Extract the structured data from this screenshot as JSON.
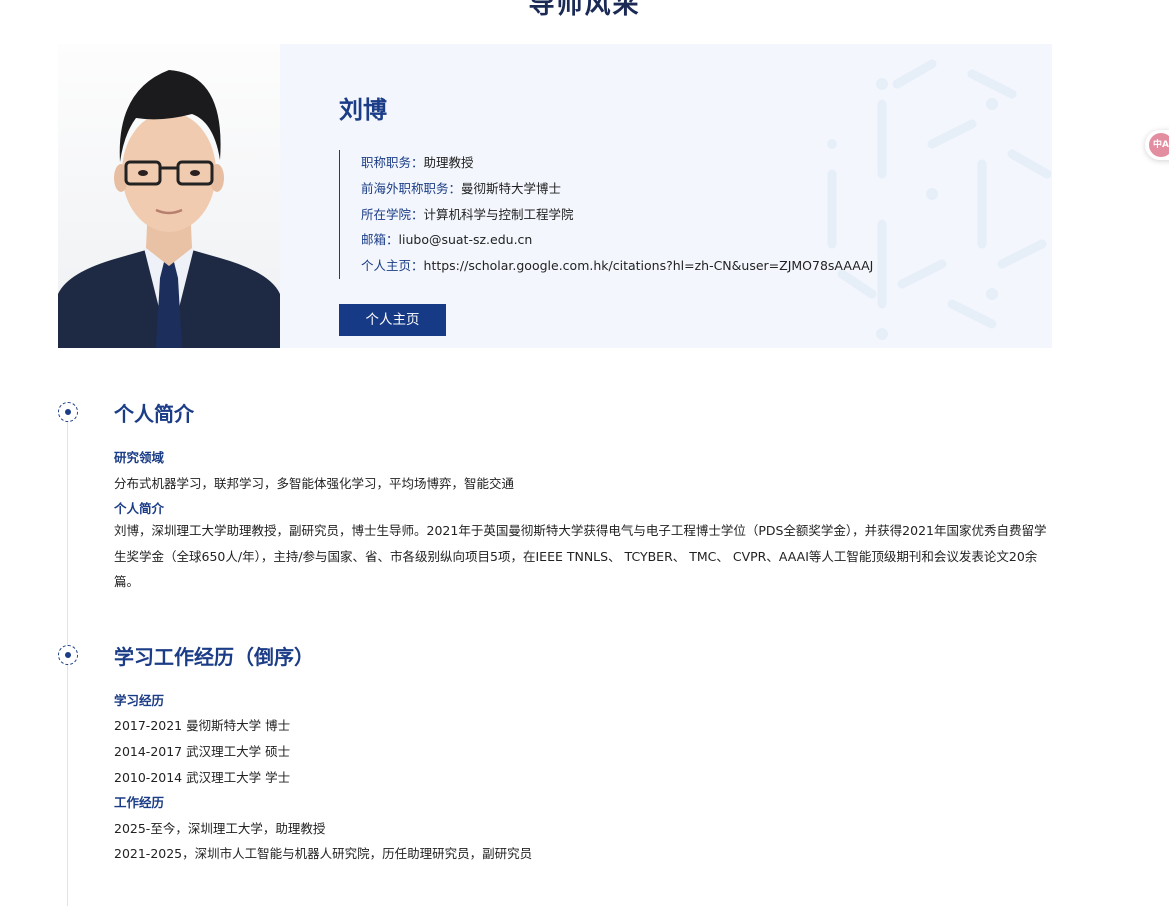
{
  "page": {
    "heading": "导师风采"
  },
  "profile": {
    "name": "刘博",
    "rows": [
      {
        "key": "职称职务：",
        "value": "助理教授"
      },
      {
        "key": "前海外职称职务：",
        "value": "曼彻斯特大学博士"
      },
      {
        "key": "所在学院：",
        "value": "计算机科学与控制工程学院"
      },
      {
        "key": "邮箱：",
        "value": "liubo@suat-sz.edu.cn"
      },
      {
        "key": "个人主页：",
        "value": "https://scholar.google.com.hk/citations?hl=zh-CN&user=ZJMO78sAAAAJ"
      }
    ],
    "homepage_button": "个人主页"
  },
  "intro": {
    "title": "个人简介",
    "research_label": "研究领域",
    "research_text": "分布式机器学习，联邦学习，多智能体强化学习，平均场博弈，智能交通",
    "bio_label": "个人简介",
    "bio_text": "刘博，深圳理工大学助理教授，副研究员，博士生导师。2021年于英国曼彻斯特大学获得电气与电子工程博士学位（PDS全额奖学金），并获得2021年国家优秀自费留学生奖学金（全球650人/年），主持/参与国家、省、市各级别纵向项目5项，在IEEE TNNLS、 TCYBER、 TMC、 CVPR、AAAI等人工智能顶级期刊和会议发表论文20余篇。"
  },
  "experience": {
    "title": "学习工作经历（倒序）",
    "study_label": "学习经历",
    "study_items": [
      "2017-2021 曼彻斯特大学 博士",
      "2014-2017 武汉理工大学 硕士",
      "2010-2014 武汉理工大学 学士"
    ],
    "work_label": "工作经历",
    "work_items": [
      "2025-至今，深圳理工大学，助理教授",
      "2021-2025，深圳市人工智能与机器人研究院，历任助理研究员，副研究员"
    ]
  },
  "floating": {
    "badge": "中A",
    "icon": "translate-icon",
    "color": "#e28ea0"
  },
  "colors": {
    "accent": "#1b3c86",
    "button": "#173a87",
    "panel": "#f3f7fd"
  }
}
